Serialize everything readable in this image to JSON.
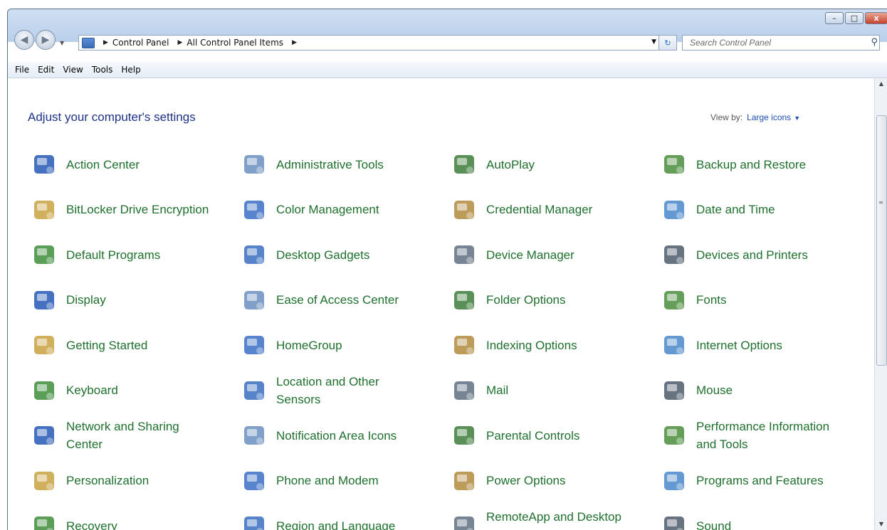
{
  "window": {
    "controls": {
      "minimize": "–",
      "maximize": "□",
      "close": "x"
    }
  },
  "addressbar": {
    "crumbs": [
      "Control Panel",
      "All Control Panel Items"
    ],
    "search_placeholder": "Search Control Panel"
  },
  "menu": [
    "File",
    "Edit",
    "View",
    "Tools",
    "Help"
  ],
  "page": {
    "heading": "Adjust your computer's settings",
    "view_by_label": "View by:",
    "view_by_value": "Large icons"
  },
  "items": [
    {
      "label": "Action Center",
      "icon": "action-center-flag-icon"
    },
    {
      "label": "Administrative Tools",
      "icon": "administrative-tools-icon"
    },
    {
      "label": "AutoPlay",
      "icon": "autoplay-icon"
    },
    {
      "label": "Backup and Restore",
      "icon": "backup-restore-icon"
    },
    {
      "label": "BitLocker Drive Encryption",
      "icon": "bitlocker-key-icon"
    },
    {
      "label": "Color Management",
      "icon": "color-management-icon"
    },
    {
      "label": "Credential Manager",
      "icon": "credential-vault-icon"
    },
    {
      "label": "Date and Time",
      "icon": "calendar-clock-icon"
    },
    {
      "label": "Default Programs",
      "icon": "default-programs-icon"
    },
    {
      "label": "Desktop Gadgets",
      "icon": "desktop-gadgets-icon"
    },
    {
      "label": "Device Manager",
      "icon": "device-manager-icon"
    },
    {
      "label": "Devices and Printers",
      "icon": "printer-icon"
    },
    {
      "label": "Display",
      "icon": "display-monitor-icon"
    },
    {
      "label": "Ease of Access Center",
      "icon": "ease-of-access-icon"
    },
    {
      "label": "Folder Options",
      "icon": "folder-options-icon"
    },
    {
      "label": "Fonts",
      "icon": "fonts-folder-icon"
    },
    {
      "label": "Getting Started",
      "icon": "getting-started-icon"
    },
    {
      "label": "HomeGroup",
      "icon": "homegroup-icon"
    },
    {
      "label": "Indexing Options",
      "icon": "indexing-magnifier-icon"
    },
    {
      "label": "Internet Options",
      "icon": "internet-globe-icon"
    },
    {
      "label": "Keyboard",
      "icon": "keyboard-icon"
    },
    {
      "label": "Location and Other Sensors",
      "icon": "location-sensor-icon"
    },
    {
      "label": "Mail",
      "icon": "mail-icon"
    },
    {
      "label": "Mouse",
      "icon": "mouse-icon"
    },
    {
      "label": "Network and Sharing Center",
      "icon": "network-icon"
    },
    {
      "label": "Notification Area Icons",
      "icon": "notification-area-icon"
    },
    {
      "label": "Parental Controls",
      "icon": "parental-controls-icon"
    },
    {
      "label": "Performance Information and Tools",
      "icon": "performance-monitor-icon"
    },
    {
      "label": "Personalization",
      "icon": "personalization-icon"
    },
    {
      "label": "Phone and Modem",
      "icon": "phone-icon"
    },
    {
      "label": "Power Options",
      "icon": "power-battery-icon"
    },
    {
      "label": "Programs and Features",
      "icon": "programs-features-icon"
    },
    {
      "label": "Recovery",
      "icon": "recovery-icon"
    },
    {
      "label": "Region and Language",
      "icon": "region-globe-icon"
    },
    {
      "label": "RemoteApp and Desktop Connections",
      "icon": "remoteapp-icon"
    },
    {
      "label": "Sound",
      "icon": "speaker-icon"
    }
  ],
  "colors": {
    "link_green": "#1f6f2e",
    "heading_blue": "#1e3287",
    "accent_blue": "#1e4fb0"
  }
}
